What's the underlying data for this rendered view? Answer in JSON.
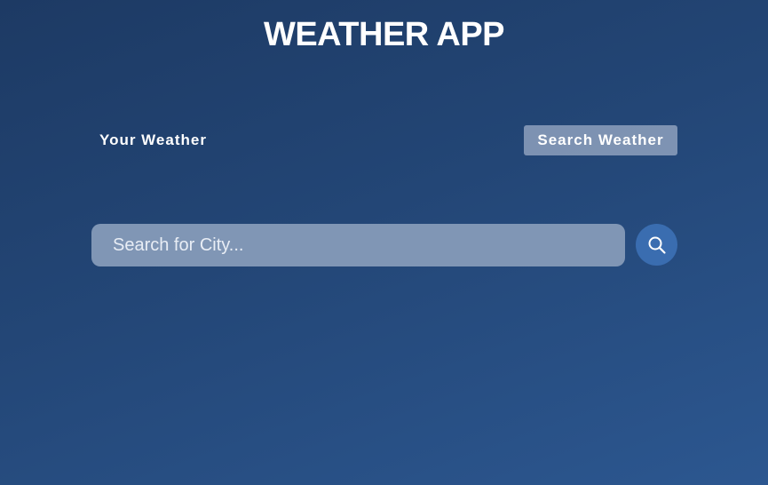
{
  "header": {
    "title": "WEATHER APP"
  },
  "tabs": [
    {
      "label": "Your Weather",
      "active": false
    },
    {
      "label": "Search Weather",
      "active": true
    }
  ],
  "search": {
    "placeholder": "Search for City...",
    "value": "",
    "button_icon": "search-icon"
  },
  "colors": {
    "background_start": "#1d3a64",
    "background_end": "#2c5790",
    "search_field": "#8096b5",
    "search_button": "#3a6db0",
    "active_tab": "#a3b1c8"
  }
}
